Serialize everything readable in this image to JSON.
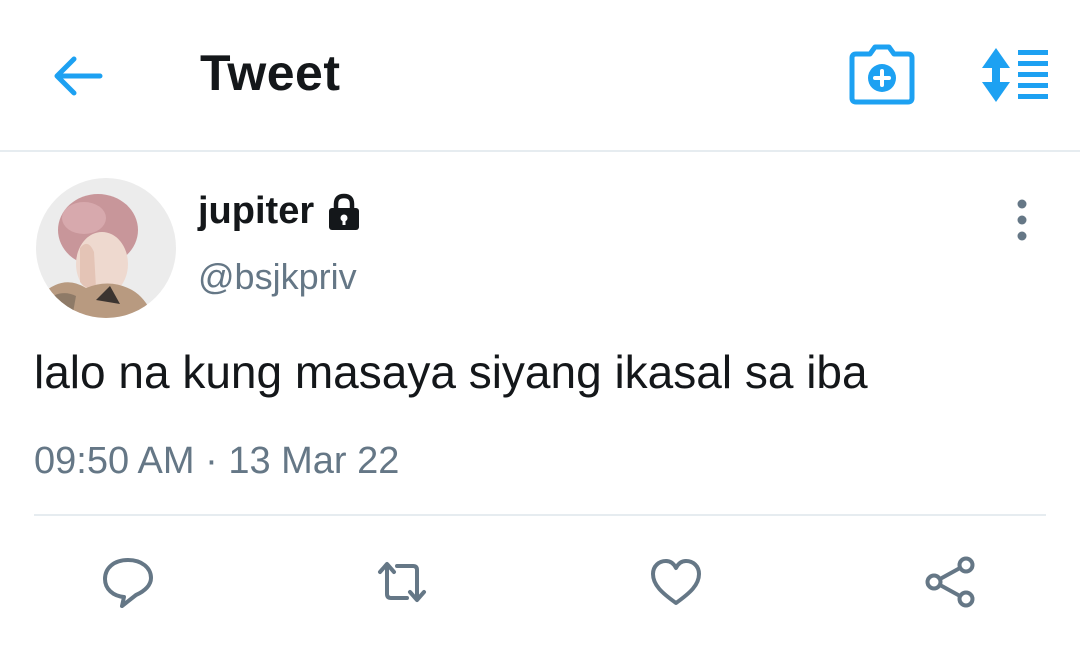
{
  "header": {
    "title": "Tweet",
    "back_icon": "arrow-left-icon",
    "camera_icon": "camera-plus-icon",
    "sort_icon": "sort-list-icon",
    "accent_color": "#1da1f2"
  },
  "tweet": {
    "author": {
      "name": "jupiter",
      "handle": "@bsjkpriv",
      "protected_icon": "lock-icon"
    },
    "text": "lalo na kung masaya siyang ikasal sa iba",
    "meta": "09:50 AM · 13 Mar 22"
  },
  "actions": [
    {
      "icon": "reply-icon"
    },
    {
      "icon": "retweet-icon"
    },
    {
      "icon": "like-icon"
    },
    {
      "icon": "share-icon"
    }
  ],
  "colors": {
    "text": "#14171a",
    "secondary": "#657786",
    "divider": "#e6ecf0"
  }
}
